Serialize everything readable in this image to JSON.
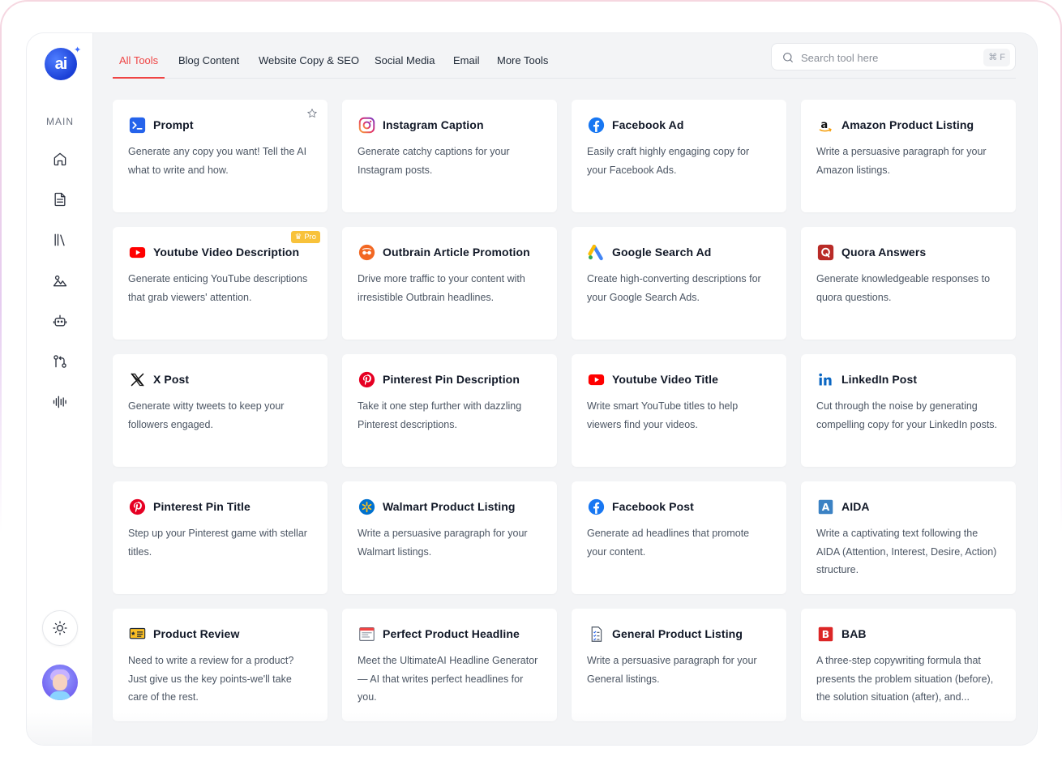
{
  "app": {
    "logo_text": "ai"
  },
  "sidebar": {
    "section_label": "MAIN",
    "icons": [
      "home-icon",
      "document-icon",
      "library-icon",
      "image-icon",
      "robot-icon",
      "git-compare-icon",
      "audio-wave-icon"
    ],
    "theme_icon": "sun-icon",
    "avatar": "user-avatar"
  },
  "tabs": [
    {
      "label": "All Tools",
      "active": true
    },
    {
      "label": "Blog Content"
    },
    {
      "label": "Website Copy & SEO"
    },
    {
      "label": "Social Media"
    },
    {
      "label": "Email"
    },
    {
      "label": "More Tools"
    }
  ],
  "search": {
    "placeholder": "Search tool here",
    "shortcut": "⌘ F"
  },
  "colors": {
    "accent": "#ef4444",
    "pro_badge": "#f8c23b"
  },
  "tools": [
    {
      "title": "Prompt",
      "icon": "terminal-icon",
      "desc": "Generate any copy you want! Tell the AI what to write and how.",
      "favorite": true
    },
    {
      "title": "Instagram Caption",
      "icon": "instagram-icon",
      "desc": "Generate catchy captions for your Instagram posts."
    },
    {
      "title": "Facebook Ad",
      "icon": "facebook-icon",
      "desc": "Easily craft highly engaging copy for your Facebook Ads."
    },
    {
      "title": "Amazon Product Listing",
      "icon": "amazon-icon",
      "desc": "Write a persuasive paragraph for your Amazon listings."
    },
    {
      "title": "Youtube Video Description",
      "icon": "youtube-icon",
      "desc": "Generate enticing YouTube descriptions that grab viewers' attention.",
      "badge": "Pro"
    },
    {
      "title": "Outbrain Article Promotion",
      "icon": "outbrain-icon",
      "desc": "Drive more traffic to your content with irresistible Outbrain headlines."
    },
    {
      "title": "Google Search Ad",
      "icon": "google-ads-icon",
      "desc": "Create high-converting descriptions for your Google Search Ads."
    },
    {
      "title": "Quora Answers",
      "icon": "quora-icon",
      "desc": "Generate knowledgeable responses to quora questions."
    },
    {
      "title": "X Post",
      "icon": "x-icon",
      "desc": "Generate witty tweets to keep your followers engaged."
    },
    {
      "title": "Pinterest Pin Description",
      "icon": "pinterest-icon",
      "desc": "Take it one step further with dazzling Pinterest descriptions."
    },
    {
      "title": "Youtube Video Title",
      "icon": "youtube-icon",
      "desc": "Write smart YouTube titles to help viewers find your videos."
    },
    {
      "title": "LinkedIn Post",
      "icon": "linkedin-icon",
      "desc": "Cut through the noise by generating compelling copy for your LinkedIn posts."
    },
    {
      "title": "Pinterest Pin Title",
      "icon": "pinterest-icon",
      "desc": "Step up your Pinterest game with stellar titles."
    },
    {
      "title": "Walmart Product Listing",
      "icon": "walmart-icon",
      "desc": "Write a persuasive paragraph for your Walmart listings."
    },
    {
      "title": "Facebook Post",
      "icon": "facebook-icon",
      "desc": "Generate ad headlines that promote your content."
    },
    {
      "title": "AIDA",
      "icon": "aida-icon",
      "desc": "Write a captivating text following the AIDA (Attention, Interest, Desire, Action) structure."
    },
    {
      "title": "Product Review",
      "icon": "review-icon",
      "desc": "Need to write a review for a product? Just give us the key points-we'll take care of the rest."
    },
    {
      "title": "Perfect Product Headline",
      "icon": "headline-icon",
      "desc": "Meet the UltimateAI Headline Generator — AI that writes perfect headlines for you."
    },
    {
      "title": "General Product Listing",
      "icon": "checklist-icon",
      "desc": "Write a persuasive paragraph for your General listings."
    },
    {
      "title": "BAB",
      "icon": "bab-icon",
      "desc": "A three-step copywriting formula that presents the problem situation (before), the solution situation (after), and..."
    }
  ]
}
